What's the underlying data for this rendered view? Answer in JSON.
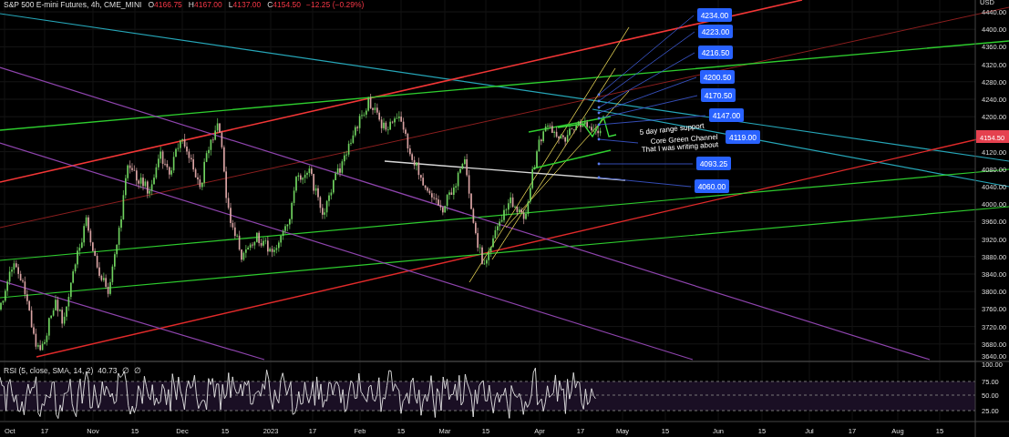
{
  "header": {
    "symbol": "S&P 500 E-mini Futures, 4h, CME_MINI",
    "ohlc": [
      {
        "label": "O",
        "value": "4166.75"
      },
      {
        "label": "H",
        "value": "4167.00"
      },
      {
        "label": "L",
        "value": "4137.00"
      },
      {
        "label": "C",
        "value": "4154.50"
      }
    ],
    "change": "−12.25 (−0.29%)"
  },
  "price_axis": {
    "unit": "USD",
    "ticks": [
      "4440.00",
      "4400.00",
      "4360.00",
      "4320.00",
      "4280.00",
      "4240.00",
      "4200.00",
      "4120.00",
      "4080.00",
      "4040.00",
      "4000.00",
      "3960.00",
      "3920.00",
      "3880.00",
      "3840.00",
      "3800.00",
      "3760.00",
      "3720.00",
      "3680.00",
      "3640.00"
    ],
    "current_price": "4154.50"
  },
  "price_labels": [
    "4234.00",
    "4223.00",
    "4216.50",
    "4200.50",
    "4170.50",
    "4147.00",
    "4119.00",
    "4093.25",
    "4060.00"
  ],
  "annotations": [
    "5 day range support",
    "Core Green Channel",
    "That I was writing about"
  ],
  "indicator": {
    "title": "RSI (5, close, SMA, 14, 2)",
    "value": "40.73",
    "extras": [
      "∅",
      "∅"
    ],
    "ticks": [
      "100.00",
      "75.00",
      "50.00",
      "25.00"
    ]
  },
  "time_axis": {
    "labels": [
      "Oct",
      "17",
      "Nov",
      "15",
      "Dec",
      "15",
      "2023",
      "17",
      "Feb",
      "15",
      "Mar",
      "15",
      "Apr",
      "17",
      "May",
      "15",
      "Jun",
      "15",
      "Jul",
      "17",
      "Aug",
      "15"
    ]
  }
}
